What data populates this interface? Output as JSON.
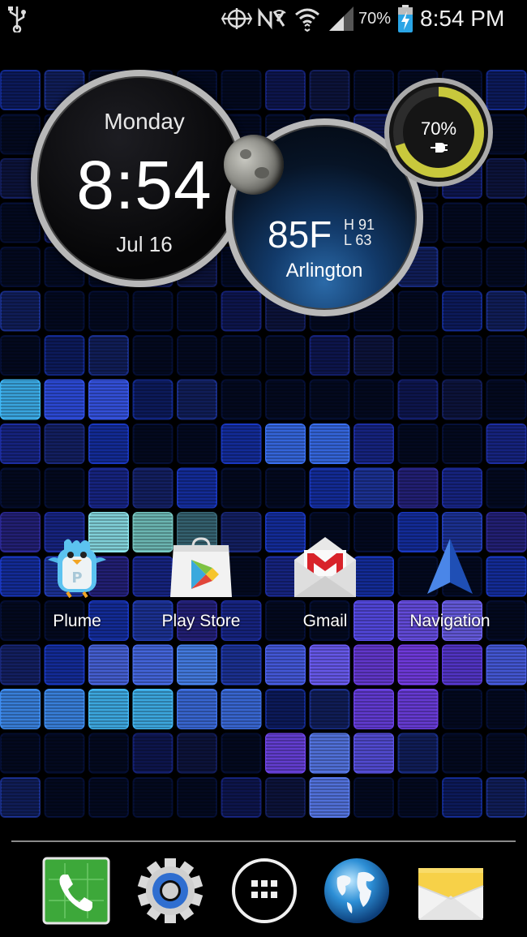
{
  "status_bar": {
    "icons": [
      "usb-icon",
      "gps-icon",
      "nfc-icon",
      "mute-icon",
      "wifi-icon",
      "signal-icon",
      "battery-charging-icon"
    ],
    "battery_percent": "70%",
    "time": "8:54 PM"
  },
  "clock_widget": {
    "day": "Monday",
    "time": "8:54",
    "date": "Jul 16"
  },
  "weather_widget": {
    "temperature": "85F",
    "high": "H 91",
    "low": "L 63",
    "city": "Arlington",
    "moon_icon": "moon-icon"
  },
  "battery_widget": {
    "percent": "70%",
    "level": 0.7,
    "icon": "charging-plug-icon",
    "arc_color": "#c8c83c"
  },
  "apps": [
    {
      "label": "Plume",
      "icon": "plume-bird-icon"
    },
    {
      "label": "Play Store",
      "icon": "play-store-icon"
    },
    {
      "label": "Gmail",
      "icon": "gmail-icon"
    },
    {
      "label": "Navigation",
      "icon": "navigation-arrow-icon"
    }
  ],
  "dock": [
    {
      "icon": "phone-icon"
    },
    {
      "icon": "settings-gear-icon"
    },
    {
      "icon": "app-drawer-icon"
    },
    {
      "icon": "browser-globe-icon"
    },
    {
      "icon": "messaging-envelope-icon"
    }
  ],
  "colors": {
    "background": "#000000",
    "tile_blue": "#1b3fd6",
    "tile_cyan": "#3fc6f0",
    "tile_purple": "#4a2bb0"
  }
}
